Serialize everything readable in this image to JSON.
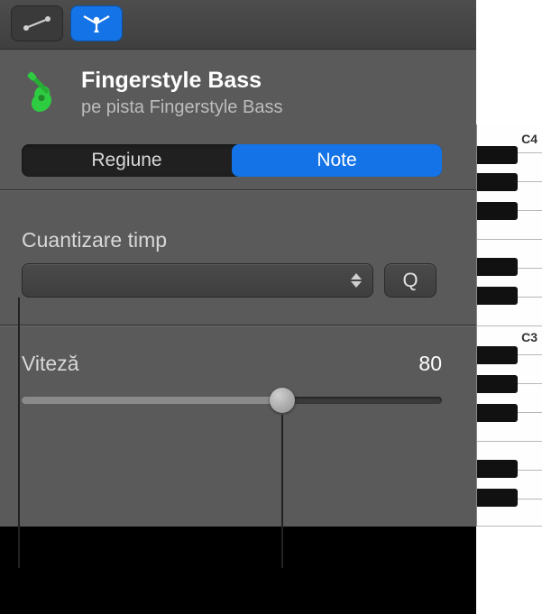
{
  "toolbar": {
    "automation_icon": "automation-curve",
    "splice_icon": "scissors-split"
  },
  "track": {
    "title": "Fingerstyle Bass",
    "subtitle": "pe pista Fingerstyle Bass"
  },
  "segmented": {
    "region_label": "Regiune",
    "note_label": "Note"
  },
  "quantize": {
    "section_label": "Cuantizare timp",
    "selected": "",
    "q_button_label": "Q"
  },
  "velocity": {
    "label": "Viteză",
    "value": "80"
  },
  "piano": {
    "labels": {
      "c4": "C4",
      "c3": "C3"
    }
  }
}
